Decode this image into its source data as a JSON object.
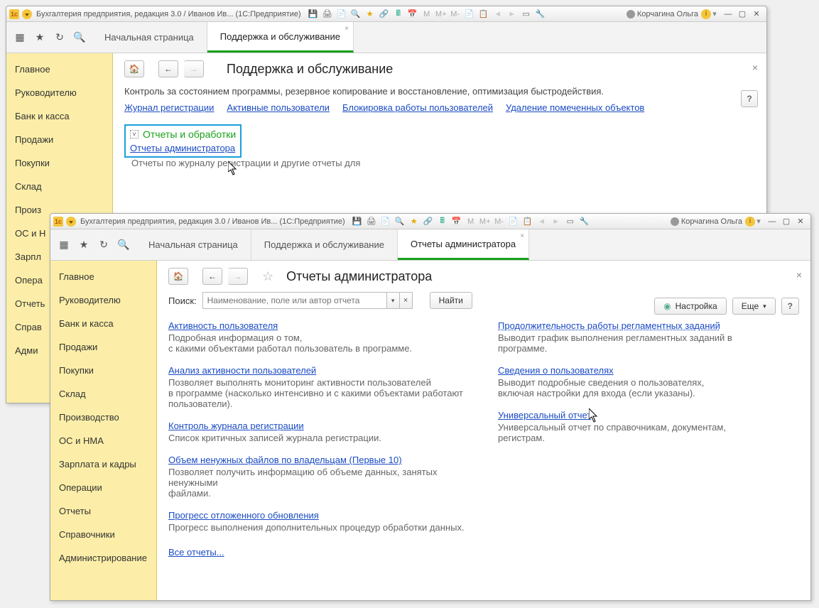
{
  "window1": {
    "title": "Бухгалтерия предприятия, редакция 3.0 / Иванов Ив...   (1С:Предприятие)",
    "user": "Корчагина Ольга",
    "tabs": [
      {
        "label": "Начальная страница",
        "active": false
      },
      {
        "label": "Поддержка и обслуживание",
        "active": true
      }
    ],
    "sidebar": [
      "Главное",
      "Руководителю",
      "Банк и касса",
      "Продажи",
      "Покупки",
      "Склад",
      "Произ",
      "ОС и Н",
      "Зарпл",
      "Опера",
      "Отчеть",
      "Справ",
      "Адми"
    ],
    "page_title": "Поддержка и обслуживание",
    "desc": "Контроль за состоянием программы, резервное копирование и восстановление, оптимизация быстродействия.",
    "links": [
      "Журнал регистрации",
      "Активные пользователи",
      "Блокировка работы пользователей",
      "Удаление помеченных объектов"
    ],
    "section_title": "Отчеты и обработки",
    "sub_link": "Отчеты администратора",
    "sub_desc": "Отчеты по журналу регистрации и другие отчеты для"
  },
  "window2": {
    "title": "Бухгалтерия предприятия, редакция 3.0 / Иванов Ив...   (1С:Предприятие)",
    "user": "Корчагина Ольга",
    "tabs": [
      {
        "label": "Начальная страница",
        "active": false
      },
      {
        "label": "Поддержка и обслуживание",
        "active": false
      },
      {
        "label": "Отчеты администратора",
        "active": true
      }
    ],
    "sidebar": [
      "Главное",
      "Руководителю",
      "Банк и касса",
      "Продажи",
      "Покупки",
      "Склад",
      "Производство",
      "ОС и НМА",
      "Зарплата и кадры",
      "Операции",
      "Отчеты",
      "Справочники",
      "Администрирование"
    ],
    "page_title": "Отчеты администратора",
    "search_label": "Поиск:",
    "search_placeholder": "Наименование, поле или автор отчета",
    "btn_find": "Найти",
    "btn_settings": "Настройка",
    "btn_more": "Еще",
    "left_items": [
      {
        "title": "Активность пользователя",
        "desc": "Подробная информация о том,\nс какими объектами работал пользователь в программе."
      },
      {
        "title": "Анализ активности пользователей",
        "desc": "Позволяет выполнять мониторинг активности пользователей\nв программе (насколько интенсивно и с какими объектами работают\nпользователи)."
      },
      {
        "title": "Контроль журнала регистрации",
        "desc": "Список критичных записей журнала регистрации."
      },
      {
        "title": "Объем ненужных файлов по владельцам (Первые 10)",
        "desc": "Позволяет получить информацию об объеме данных, занятых ненужными\nфайлами."
      },
      {
        "title": "Прогресс отложенного обновления",
        "desc": "Прогресс выполнения дополнительных процедур обработки данных."
      }
    ],
    "right_items": [
      {
        "title": "Продолжительность работы регламентных заданий",
        "desc": "Выводит график выполнения регламентных заданий в\nпрограмме.",
        "dotted": true
      },
      {
        "title": "Сведения о пользователях",
        "desc": "Выводит подробные сведения о пользователях,\nвключая настройки для входа (если указаны)."
      },
      {
        "title": "Универсальный отчет",
        "desc": "Универсальный отчет по справочникам, документам,\nрегистрам."
      }
    ],
    "all_reports": "Все отчеты..."
  }
}
